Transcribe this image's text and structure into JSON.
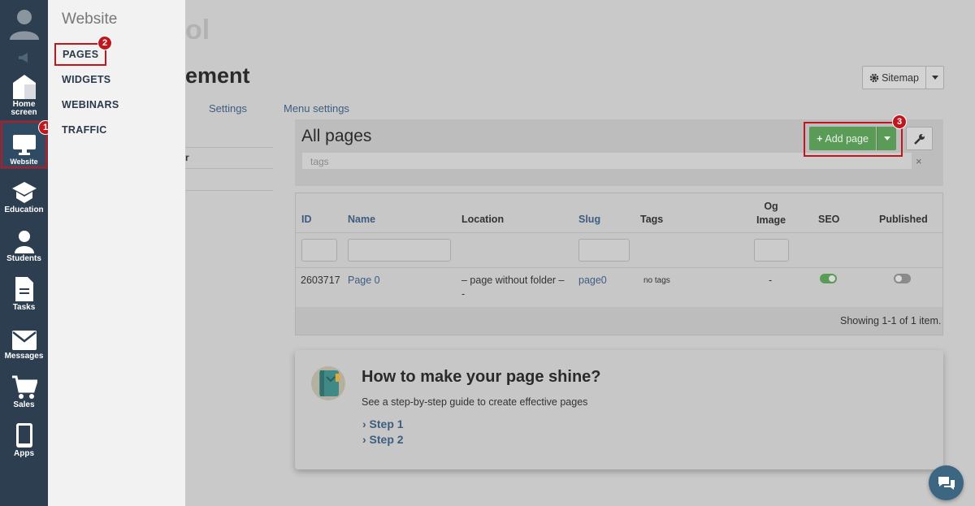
{
  "rail": {
    "items": [
      {
        "label": "Home screen",
        "icon": "house-icon"
      },
      {
        "label": "Website",
        "icon": "monitor-icon"
      },
      {
        "label": "Education",
        "icon": "graduation-cap-icon"
      },
      {
        "label": "Students",
        "icon": "person-icon"
      },
      {
        "label": "Tasks",
        "icon": "document-icon"
      },
      {
        "label": "Messages",
        "icon": "envelope-icon"
      },
      {
        "label": "Sales",
        "icon": "cart-icon"
      },
      {
        "label": "Apps",
        "icon": "phone-icon"
      }
    ]
  },
  "flyout": {
    "title": "Website",
    "items": [
      "PAGES",
      "WIDGETS",
      "WEBINARS",
      "TRAFFIC"
    ]
  },
  "badges": {
    "one": "1",
    "two": "2",
    "three": "3"
  },
  "header": {
    "faint_title": "ol",
    "title": "ement",
    "tabs": [
      "Settings",
      "Menu settings"
    ],
    "sitemap_label": "Sitemap"
  },
  "left_list": {
    "text": "r"
  },
  "pages": {
    "title": "All pages",
    "tags_placeholder": "tags",
    "tags_clear": "×",
    "add_label": "Add page"
  },
  "table": {
    "columns": [
      "ID",
      "Name",
      "Location",
      "Slug",
      "Tags",
      "Og Image",
      "SEO",
      "Published"
    ],
    "columns_og_line1": "Og",
    "columns_og_line2": "Image",
    "rows": [
      {
        "id": "2603717",
        "name": "Page 0",
        "location_line1": "– page without folder –",
        "location_line2": "-",
        "slug": "page0",
        "tags": "no tags",
        "og_image": "-",
        "seo": true,
        "published": false
      }
    ],
    "footer": "Showing 1-1 of 1 item."
  },
  "shine": {
    "title": "How to make your page shine?",
    "subtitle": "See a step-by-step guide to create effective pages",
    "steps": [
      "› Step 1",
      "› Step 2"
    ]
  },
  "colors": {
    "rail_bg": "#2c3e50",
    "highlight_red": "#c0161d",
    "add_green": "#5a9c57",
    "link_blue": "#3d5d80"
  }
}
